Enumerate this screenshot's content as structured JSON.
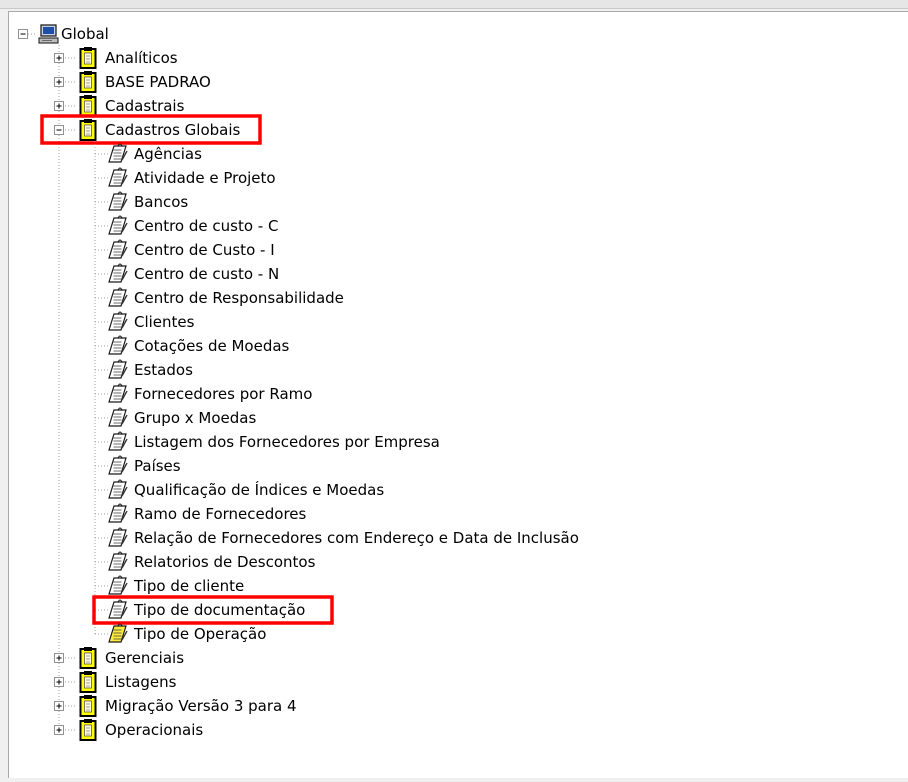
{
  "tree": {
    "root": {
      "label": "Global",
      "icon": "computer-icon",
      "expanded": true
    },
    "folders": [
      {
        "label": "Analíticos",
        "expanded": false,
        "icon": "clipboard-folder-icon",
        "highlighted": false
      },
      {
        "label": "BASE PADRAO",
        "expanded": false,
        "icon": "clipboard-folder-icon",
        "highlighted": false
      },
      {
        "label": "Cadastrais",
        "expanded": false,
        "icon": "clipboard-folder-icon",
        "highlighted": false
      },
      {
        "label": "Cadastros Globais",
        "expanded": true,
        "icon": "clipboard-folder-icon",
        "highlighted": true,
        "children": [
          {
            "label": "Agências",
            "icon": "report-icon"
          },
          {
            "label": "Atividade e Projeto",
            "icon": "report-icon"
          },
          {
            "label": "Bancos",
            "icon": "report-icon"
          },
          {
            "label": "Centro de custo - C",
            "icon": "report-icon"
          },
          {
            "label": "Centro de Custo - I",
            "icon": "report-icon"
          },
          {
            "label": "Centro de custo - N",
            "icon": "report-icon"
          },
          {
            "label": "Centro de Responsabilidade",
            "icon": "report-icon"
          },
          {
            "label": "Clientes",
            "icon": "report-icon"
          },
          {
            "label": "Cotações de Moedas",
            "icon": "report-icon"
          },
          {
            "label": "Estados",
            "icon": "report-icon"
          },
          {
            "label": "Fornecedores por Ramo",
            "icon": "report-icon"
          },
          {
            "label": "Grupo x Moedas",
            "icon": "report-icon"
          },
          {
            "label": "Listagem dos Fornecedores por Empresa",
            "icon": "report-icon"
          },
          {
            "label": "Países",
            "icon": "report-icon"
          },
          {
            "label": "Qualificação de Índices e Moedas",
            "icon": "report-icon"
          },
          {
            "label": "Ramo de Fornecedores",
            "icon": "report-icon"
          },
          {
            "label": "Relação de Fornecedores com Endereço e Data de Inclusão",
            "icon": "report-icon"
          },
          {
            "label": "Relatorios de Descontos",
            "icon": "report-icon"
          },
          {
            "label": "Tipo de cliente",
            "icon": "report-icon"
          },
          {
            "label": "Tipo de documentação",
            "icon": "report-icon",
            "highlighted": true
          },
          {
            "label": "Tipo de Operação",
            "icon": "report-icon",
            "yellow": true
          }
        ]
      },
      {
        "label": "Gerenciais",
        "expanded": false,
        "icon": "clipboard-folder-icon",
        "highlighted": false
      },
      {
        "label": "Listagens",
        "expanded": false,
        "icon": "clipboard-folder-icon",
        "highlighted": false
      },
      {
        "label": "Migração Versão 3 para 4",
        "expanded": false,
        "icon": "clipboard-folder-icon",
        "highlighted": false
      },
      {
        "label": "Operacionais",
        "expanded": false,
        "icon": "clipboard-folder-icon",
        "highlighted": false
      }
    ],
    "colors": {
      "highlight": "#ff0000",
      "clipboard_fill": "#ffff00",
      "guide": "#a0a0a0"
    }
  }
}
